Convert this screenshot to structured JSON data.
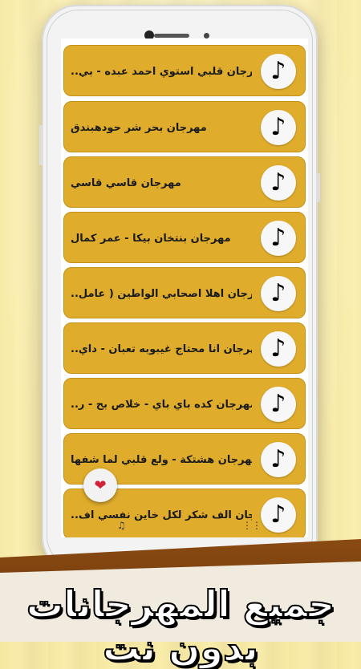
{
  "list": {
    "items": [
      {
        "title": "مهرجان قلبي استوي احمد عبده - بي..",
        "icon": "music-note-icon"
      },
      {
        "title": "مهرجان بحر شر حودهبندق",
        "icon": "music-note-icon"
      },
      {
        "title": "مهرجان قاسي قاسي",
        "icon": "music-note-icon"
      },
      {
        "title": "مهرجان بنتخان بيكا - عمر كمال",
        "icon": "music-note-icon"
      },
      {
        "title": "مهرجان اهلا اصحابي الواطين ( عامل..",
        "icon": "music-note-icon"
      },
      {
        "title": "مهرجان انا محتاج غيبوبه تعبان - داي..",
        "icon": "music-note-icon"
      },
      {
        "title": "مهرجان كده باي باي - خلاص بح - ر..",
        "icon": "music-note-icon"
      },
      {
        "title": "مهرجان هشتكة - ولع قلبي لما شفها",
        "icon": "music-note-icon"
      },
      {
        "title": "مهرجان الف شكر لكل خاين نفسي اف..",
        "icon": "music-note-icon"
      }
    ]
  },
  "favorite_button": {
    "icon": "heart-icon"
  },
  "banner": {
    "text": "جميع المهرجانات بدون نت"
  },
  "colors": {
    "item_bg": "#dfac2c",
    "banner_brown": "#7a4110",
    "heart": "#d3213a"
  }
}
